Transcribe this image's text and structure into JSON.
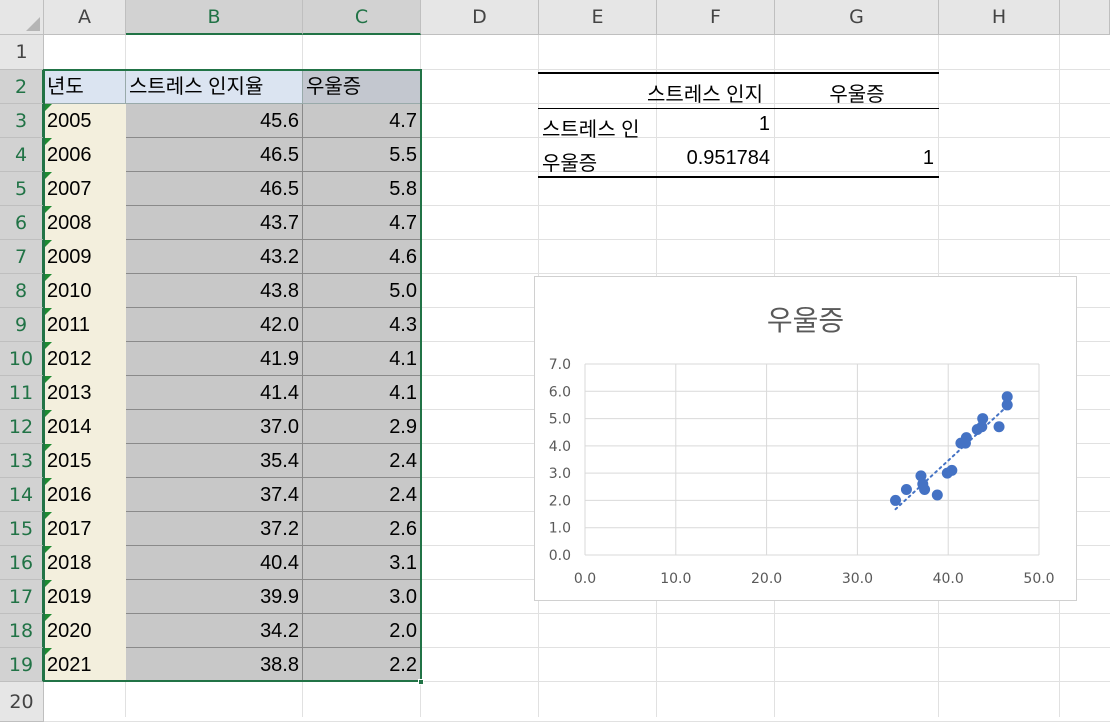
{
  "columns": [
    "A",
    "B",
    "C",
    "D",
    "E",
    "F",
    "G",
    "H"
  ],
  "rows": [
    "1",
    "2",
    "3",
    "4",
    "5",
    "6",
    "7",
    "8",
    "9",
    "10",
    "11",
    "12",
    "13",
    "14",
    "15",
    "16",
    "17",
    "18",
    "19",
    "20"
  ],
  "table": {
    "headers": [
      "년도",
      "스트레스 인지율",
      "우울증"
    ],
    "data": [
      [
        "2005",
        "45.6",
        "4.7"
      ],
      [
        "2006",
        "46.5",
        "5.5"
      ],
      [
        "2007",
        "46.5",
        "5.8"
      ],
      [
        "2008",
        "43.7",
        "4.7"
      ],
      [
        "2009",
        "43.2",
        "4.6"
      ],
      [
        "2010",
        "43.8",
        "5.0"
      ],
      [
        "2011",
        "42.0",
        "4.3"
      ],
      [
        "2012",
        "41.9",
        "4.1"
      ],
      [
        "2013",
        "41.4",
        "4.1"
      ],
      [
        "2014",
        "37.0",
        "2.9"
      ],
      [
        "2015",
        "35.4",
        "2.4"
      ],
      [
        "2016",
        "37.4",
        "2.4"
      ],
      [
        "2017",
        "37.2",
        "2.6"
      ],
      [
        "2018",
        "40.4",
        "3.1"
      ],
      [
        "2019",
        "39.9",
        "3.0"
      ],
      [
        "2020",
        "34.2",
        "2.0"
      ],
      [
        "2021",
        "38.8",
        "2.2"
      ]
    ]
  },
  "correlation": {
    "col_headers": [
      "스트레스 인지",
      "우울증"
    ],
    "rows": [
      {
        "label": "스트레스 인",
        "values": [
          "1",
          ""
        ]
      },
      {
        "label": "우울증",
        "values": [
          "0.951784",
          "1"
        ]
      }
    ]
  },
  "colors": {
    "accent": "#217346",
    "marker": "#4472c4",
    "selection": "#c8c8c8"
  },
  "chart_data": {
    "type": "scatter",
    "title": "우울증",
    "xlim": [
      0,
      50
    ],
    "ylim": [
      0,
      7
    ],
    "x_ticks": [
      "0.0",
      "10.0",
      "20.0",
      "30.0",
      "40.0",
      "50.0"
    ],
    "y_ticks": [
      "0.0",
      "1.0",
      "2.0",
      "3.0",
      "4.0",
      "5.0",
      "6.0",
      "7.0"
    ],
    "grid": true,
    "trendline": "linear",
    "x": [
      45.6,
      46.5,
      46.5,
      43.7,
      43.2,
      43.8,
      42.0,
      41.9,
      41.4,
      37.0,
      35.4,
      37.4,
      37.2,
      40.4,
      39.9,
      34.2,
      38.8
    ],
    "y": [
      4.7,
      5.5,
      5.8,
      4.7,
      4.6,
      5.0,
      4.3,
      4.1,
      4.1,
      2.9,
      2.4,
      2.4,
      2.6,
      3.1,
      3.0,
      2.0,
      2.2
    ]
  }
}
